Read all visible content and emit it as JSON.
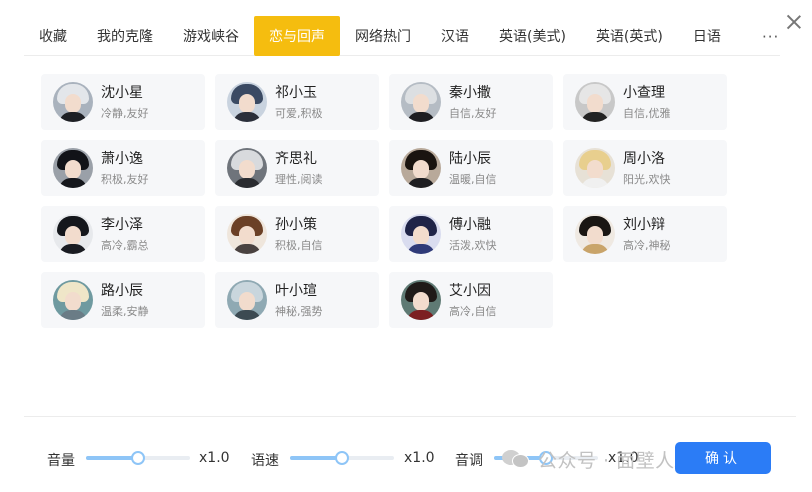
{
  "tabs": [
    {
      "label": "收藏",
      "active": false
    },
    {
      "label": "我的克隆",
      "active": false
    },
    {
      "label": "游戏峡谷",
      "active": false
    },
    {
      "label": "恋与回声",
      "active": true
    },
    {
      "label": "网络热门",
      "active": false
    },
    {
      "label": "汉语",
      "active": false
    },
    {
      "label": "英语(美式)",
      "active": false
    },
    {
      "label": "英语(英式)",
      "active": false
    },
    {
      "label": "日语",
      "active": false
    }
  ],
  "more_label": "···",
  "voices": [
    {
      "name": "沈小星",
      "tags": "冷静,友好",
      "hair": "#e3e6ea",
      "suit": "#1d1f24",
      "bg": "#a9b2bd"
    },
    {
      "name": "祁小玉",
      "tags": "可爱,积极",
      "hair": "#3b4a63",
      "suit": "#2b2f3a",
      "bg": "#c9d3df"
    },
    {
      "name": "秦小撒",
      "tags": "自信,友好",
      "hair": "#dcdfe2",
      "suit": "#1e1e22",
      "bg": "#b5bcc4"
    },
    {
      "name": "小查理",
      "tags": "自信,优雅",
      "hair": "#e6e6e6",
      "suit": "#222",
      "bg": "#c8c8c8"
    },
    {
      "name": "萧小逸",
      "tags": "积极,友好",
      "hair": "#111318",
      "suit": "#15171c",
      "bg": "#9aa0a8"
    },
    {
      "name": "齐思礼",
      "tags": "理性,阅读",
      "hair": "#d8dadd",
      "suit": "#2a2c30",
      "bg": "#6f747b"
    },
    {
      "name": "陆小辰",
      "tags": "温暖,自信",
      "hair": "#1a1410",
      "suit": "#1f1f22",
      "bg": "#b8a99a"
    },
    {
      "name": "周小洛",
      "tags": "阳光,欢快",
      "hair": "#e8cf8e",
      "suit": "#f0f0f0",
      "bg": "#e7e1d6"
    },
    {
      "name": "李小泽",
      "tags": "高冷,霸总",
      "hair": "#15171c",
      "suit": "#1a1c22",
      "bg": "#e7e9ec"
    },
    {
      "name": "孙小策",
      "tags": "积极,自信",
      "hair": "#6b4026",
      "suit": "#4a4240",
      "bg": "#efe6dc"
    },
    {
      "name": "傅小融",
      "tags": "活泼,欢快",
      "hair": "#1f2448",
      "suit": "#2f3a78",
      "bg": "#d9dcef"
    },
    {
      "name": "刘小辩",
      "tags": "高冷,神秘",
      "hair": "#1a1613",
      "suit": "#c9a46a",
      "bg": "#efe9e2"
    },
    {
      "name": "路小辰",
      "tags": "温柔,安静",
      "hair": "#efe6c8",
      "suit": "#6a7c86",
      "bg": "#6f9aa0"
    },
    {
      "name": "叶小瑄",
      "tags": "神秘,强势",
      "hair": "#c9d6dd",
      "suit": "#3c4a52",
      "bg": "#8fa9b3"
    },
    {
      "name": "艾小因",
      "tags": "高冷,自信",
      "hair": "#1f1a18",
      "suit": "#7c1f22",
      "bg": "#5f7a74"
    }
  ],
  "controls": {
    "volume": {
      "label": "音量",
      "value": "x1.0",
      "level": 0.5
    },
    "speed": {
      "label": "语速",
      "value": "x1.0",
      "level": 0.5
    },
    "pitch": {
      "label": "音调",
      "value": "x1.0",
      "level": 0.5
    }
  },
  "watermark": "公众号 · 面壁人AI工具库",
  "confirm_label": "确认",
  "colors": {
    "accent": "#f5bd0f",
    "primary": "#2b7cf6",
    "slider": "#8ec5f7"
  }
}
